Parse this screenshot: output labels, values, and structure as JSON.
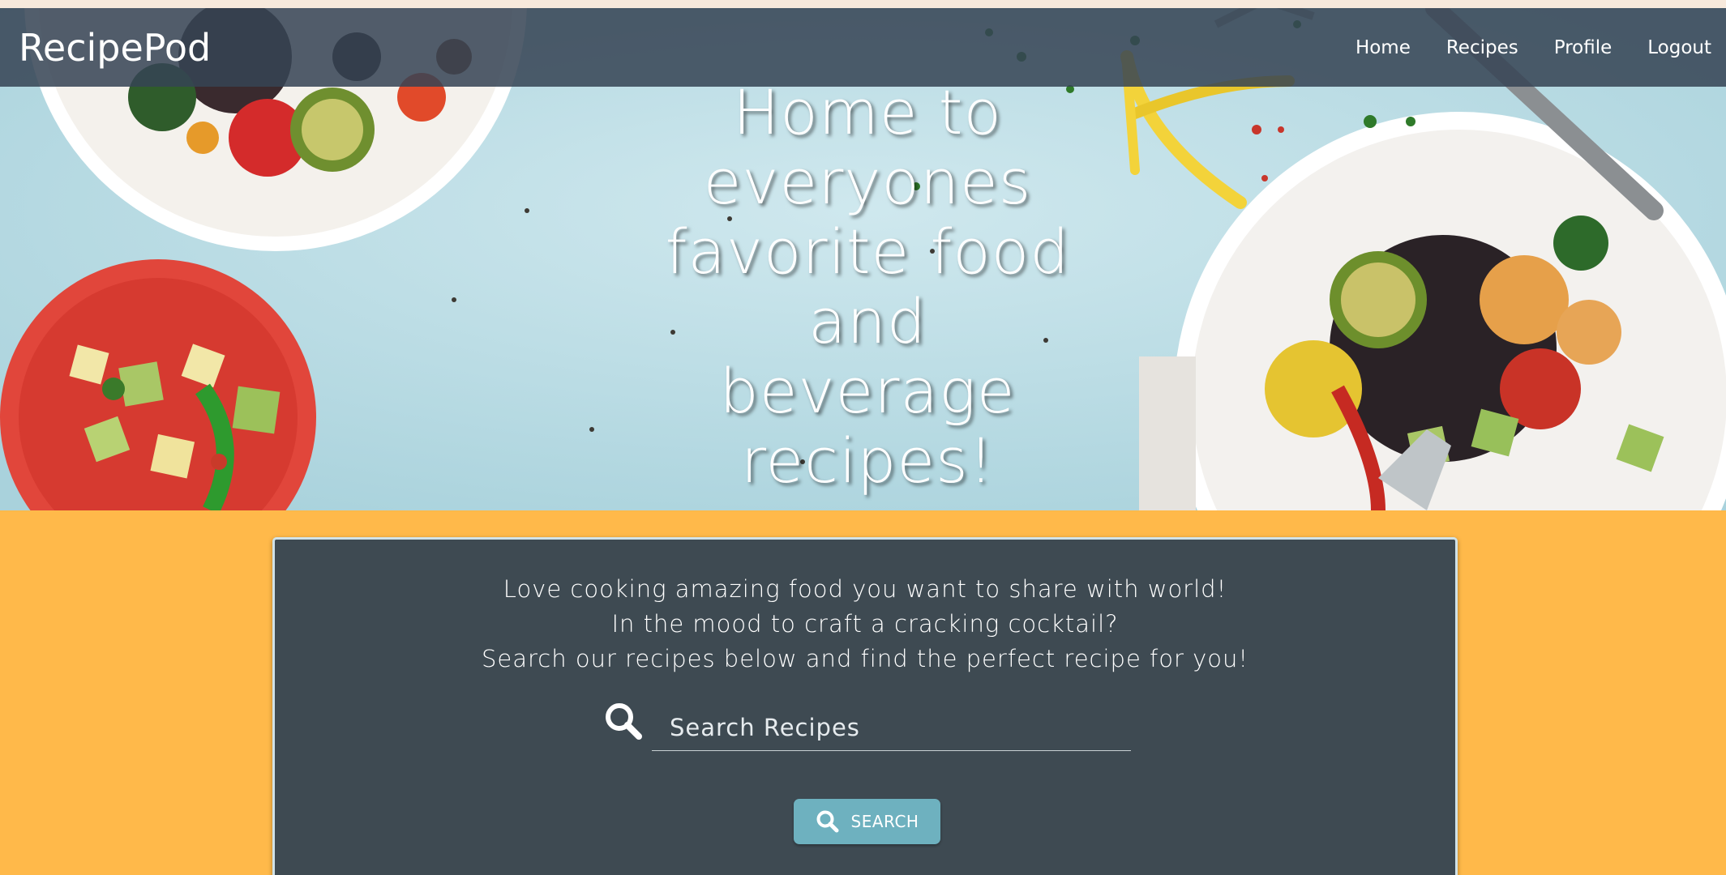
{
  "navbar": {
    "brand": "RecipePod",
    "links": [
      {
        "label": "Home"
      },
      {
        "label": "Recipes"
      },
      {
        "label": "Profile"
      },
      {
        "label": "Logout"
      }
    ]
  },
  "hero": {
    "headline": "Home to everyones favorite food and beverage recipes!"
  },
  "card": {
    "intro_lines": [
      "Love cooking amazing food you want to share with world!",
      "In the mood to craft a cracking cocktail?",
      "Search our recipes below and find the perfect recipe for you!"
    ],
    "search": {
      "placeholder": "Search Recipes",
      "value": ""
    },
    "button_label": "SEARCH"
  },
  "colors": {
    "navbar_bg": "#354454",
    "page_bg": "#ffb94a",
    "card_bg": "#3e4a52",
    "button_bg": "#6eb1bf",
    "hero_bg": "#b7dbe5"
  },
  "icons": {
    "search_field_icon": "search-icon",
    "button_icon": "search-icon"
  }
}
